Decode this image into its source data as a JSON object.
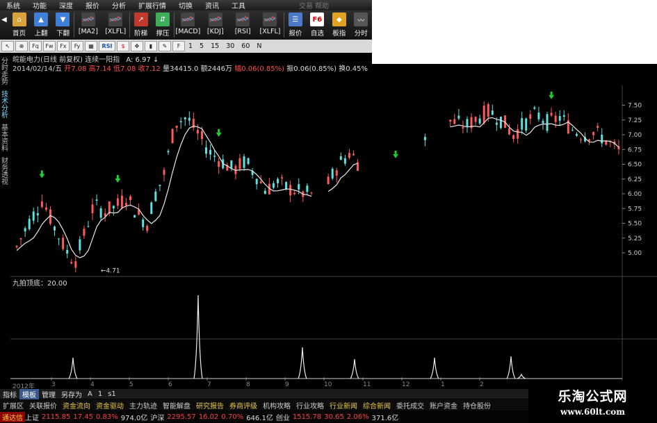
{
  "menubar": {
    "items": [
      "系统",
      "功能",
      "深度",
      "报价",
      "分析",
      "扩展行情",
      "切换",
      "资讯",
      "工具"
    ],
    "extra": "交易 帮助"
  },
  "toolbar": {
    "buttons": [
      {
        "label": "首页",
        "icon": "home-icon",
        "color": "#d9a23a"
      },
      {
        "label": "上翻",
        "icon": "arrow-up-icon",
        "color": "#3f7fd8"
      },
      {
        "label": "下翻",
        "icon": "arrow-down-icon",
        "color": "#3f7fd8"
      },
      {
        "label": "[MA2]",
        "icon": "ma2-chart-icon",
        "color": "#444"
      },
      {
        "label": "[XLFL]",
        "icon": "xlfl-chart-icon",
        "color": "#444"
      },
      {
        "label": "阶梯",
        "icon": "ladder-icon",
        "color": "#c0392b"
      },
      {
        "label": "撑压",
        "icon": "support-pressure-icon",
        "color": "#3fae5a"
      },
      {
        "label": "[MACD]",
        "icon": "macd-chart-icon",
        "color": "#444"
      },
      {
        "label": "[KDJ]",
        "icon": "kdj-chart-icon",
        "color": "#444"
      },
      {
        "label": "[RSI]",
        "icon": "rsi-chart-icon",
        "color": "#444"
      },
      {
        "label": "[XLFL]",
        "icon": "xlfl2-chart-icon",
        "color": "#444"
      },
      {
        "label": "报价",
        "icon": "quote-icon",
        "color": "#4a7ac8"
      },
      {
        "label": "自选",
        "icon": "f6-favorites-icon",
        "color": "#ffffff"
      },
      {
        "label": "板指",
        "icon": "sector-index-icon",
        "color": "#e0a020"
      },
      {
        "label": "分时",
        "icon": "intraday-icon",
        "color": "#555"
      }
    ]
  },
  "toolbar2": {
    "tools": [
      "cursor-icon",
      "zoom-in-icon",
      "fq-icon",
      "fw-icon",
      "fx-icon",
      "fy-icon",
      "layout-icon",
      "rsi-icon",
      "dollar-icon",
      "move-icon",
      "bar-icon",
      "pencil-icon",
      "edit-icon"
    ],
    "rsi_label": "RSI",
    "periods": [
      "1",
      "5",
      "15",
      "30",
      "60",
      "N"
    ]
  },
  "stock": {
    "title": "皖能电力(日线 前复权) 连续一阳指",
    "a_value": "A: 6.97",
    "date": "2014/02/14/五",
    "open_label": "开",
    "open": "7.08",
    "high_label": "高",
    "high": "7.14",
    "low_label": "低",
    "low": "7.08",
    "close_label": "收",
    "close": "7.12",
    "vol_label": "量",
    "vol": "34415.0",
    "amt_label": "额",
    "amt": "2446万",
    "chg_label": "幅",
    "chg": "0.06(0.85%)",
    "amp_label": "振",
    "amp": "0.06(0.85%)",
    "turn_label": "换",
    "turn": "0.45%"
  },
  "side_tabs": [
    "分时走势",
    "技术分析",
    "基本资料",
    "财务透视"
  ],
  "price_axis": [
    "7.50",
    "7.25",
    "7.00",
    "6.75",
    "6.50",
    "6.25",
    "6.00",
    "5.75",
    "5.50",
    "5.25",
    "5.00"
  ],
  "low_marker": "4.71",
  "indicator": {
    "title": "九拍顶底：20.00"
  },
  "date_axis": [
    "2012年",
    "3",
    "4",
    "5",
    "6",
    "7",
    "8",
    "9",
    "10",
    "11",
    "12",
    "1",
    "2"
  ],
  "tabs_row": [
    "指标",
    "模板",
    "管理",
    "另存为",
    "A",
    "1",
    "s1"
  ],
  "nav_row": [
    {
      "t": "扩展区",
      "hl": false
    },
    {
      "t": "关联报价",
      "hl": false
    },
    {
      "t": "资金流向",
      "hl": true
    },
    {
      "t": "资金驱动",
      "hl": true
    },
    {
      "t": "主力轨迹",
      "hl": false
    },
    {
      "t": "智能解盘",
      "hl": false
    },
    {
      "t": "研究报告",
      "hl": true
    },
    {
      "t": "券商评级",
      "hl": true
    },
    {
      "t": "机构攻略",
      "hl": false
    },
    {
      "t": "行业攻略",
      "hl": false
    },
    {
      "t": "行业新闻",
      "hl": true
    },
    {
      "t": "综合新闻",
      "hl": true
    },
    {
      "t": "委托成交",
      "hl": false
    },
    {
      "t": "账户资金",
      "hl": false
    },
    {
      "t": "持仓股份",
      "hl": false
    }
  ],
  "ticker": [
    {
      "t": "通达信",
      "c": "#ffd040"
    },
    {
      "t": "上证",
      "c": "#ddd"
    },
    {
      "t": "2115.85",
      "c": "#ff4040"
    },
    {
      "t": "17.45",
      "c": "#ff4040"
    },
    {
      "t": "0.83%",
      "c": "#ff4040"
    },
    {
      "t": "974.0亿",
      "c": "#ddd"
    },
    {
      "t": "沪深",
      "c": "#ddd"
    },
    {
      "t": "2295.57",
      "c": "#ff4040"
    },
    {
      "t": "16.02",
      "c": "#ff4040"
    },
    {
      "t": "0.70%",
      "c": "#ff4040"
    },
    {
      "t": "646.1亿",
      "c": "#ddd"
    },
    {
      "t": "创业",
      "c": "#ddd"
    },
    {
      "t": "1515.78",
      "c": "#ff4040"
    },
    {
      "t": "30.65",
      "c": "#ff4040"
    },
    {
      "t": "2.06%",
      "c": "#ff4040"
    },
    {
      "t": "371.6亿",
      "c": "#ddd"
    }
  ],
  "brand": {
    "name": "乐淘公式网",
    "url": "www.60lt.com"
  },
  "colors": {
    "up": "#ff5a5a",
    "down": "#5fe0e0",
    "ma": "#e8e8e8",
    "signal": "#22cc33"
  },
  "chart_data": {
    "type": "candlestick",
    "y_range": [
      4.6,
      7.6
    ],
    "arrows_buy": [
      0.5,
      2.0,
      4.0,
      7.5,
      10.6
    ],
    "x_ticks": [
      "3",
      "4",
      "5",
      "6",
      "7",
      "8",
      "9",
      "10",
      "11",
      "12",
      "1",
      "2"
    ]
  }
}
